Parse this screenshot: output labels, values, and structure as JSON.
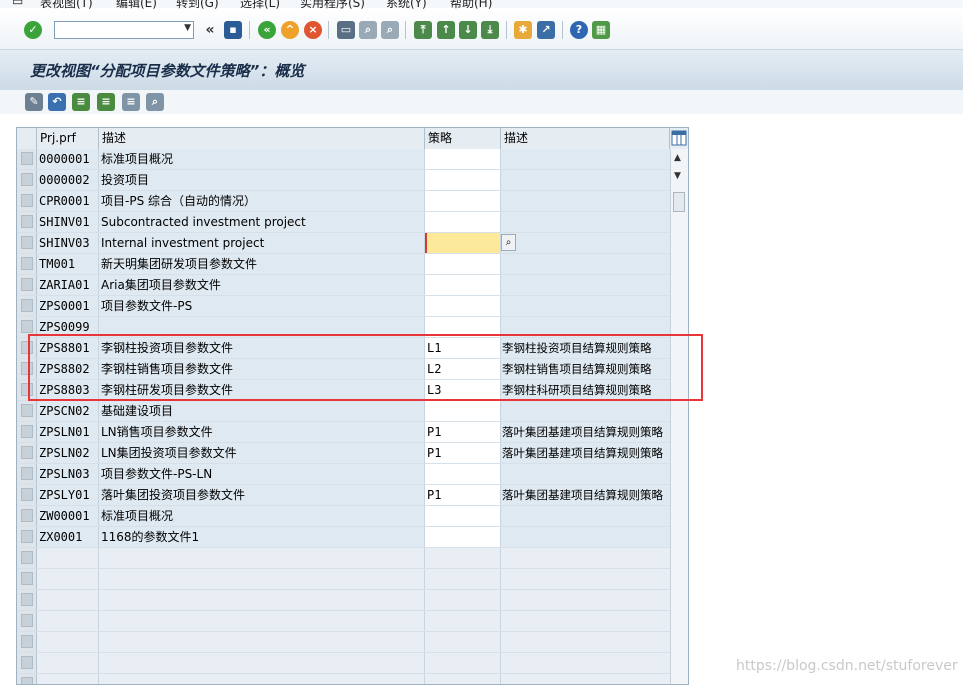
{
  "menu": [
    "表视图(T)",
    "编辑(E)",
    "转到(G)",
    "选择(L)",
    "实用程序(S)",
    "系统(Y)",
    "帮助(H)"
  ],
  "toolbar": {
    "command_field_value": "",
    "icons": [
      "enter-icon",
      "back-icon",
      "save-icon",
      "back-nav-icon",
      "exit-icon",
      "cancel-icon",
      "print-icon",
      "find-icon",
      "find-next-icon",
      "first-page-icon",
      "prev-page-icon",
      "next-page-icon",
      "last-page-icon",
      "new-session-icon",
      "shortcut-icon",
      "help-icon",
      "layout-icon"
    ]
  },
  "title": "更改视图“分配项目参数文件策略”：概览",
  "app_toolbar_icons": [
    "display-change-icon",
    "undo-icon",
    "select-all-icon",
    "select-block-icon",
    "deselect-icon",
    "other-entry-icon"
  ],
  "table": {
    "headers": [
      "Prj.prf",
      "描述",
      "策略",
      "描述"
    ],
    "rows": [
      {
        "prof": "0000001",
        "desc": "标准项目概况",
        "strat": "",
        "sdesc": ""
      },
      {
        "prof": "0000002",
        "desc": "投资项目",
        "strat": "",
        "sdesc": ""
      },
      {
        "prof": "CPR0001",
        "desc": "项目-PS 综合（自动的情况）",
        "strat": "",
        "sdesc": ""
      },
      {
        "prof": "SHINV01",
        "desc": "Subcontracted investment project",
        "strat": "",
        "sdesc": ""
      },
      {
        "prof": "SHINV03",
        "desc": "Internal investment project",
        "strat": "",
        "sdesc": ""
      },
      {
        "prof": "TM001",
        "desc": "新天明集团研发项目参数文件",
        "strat": "",
        "sdesc": ""
      },
      {
        "prof": "ZARIA01",
        "desc": "Aria集团项目参数文件",
        "strat": "",
        "sdesc": ""
      },
      {
        "prof": "ZPS0001",
        "desc": "项目参数文件-PS",
        "strat": "",
        "sdesc": ""
      },
      {
        "prof": "ZPS0099",
        "desc": "",
        "strat": "",
        "sdesc": ""
      },
      {
        "prof": "ZPS8801",
        "desc": "李钢柱投资项目参数文件",
        "strat": "L1",
        "sdesc": "李钢柱投资项目结算规则策略"
      },
      {
        "prof": "ZPS8802",
        "desc": "李钢柱销售项目参数文件",
        "strat": "L2",
        "sdesc": "李钢柱销售项目结算规则策略"
      },
      {
        "prof": "ZPS8803",
        "desc": "李钢柱研发项目参数文件",
        "strat": "L3",
        "sdesc": "李钢柱科研项目结算规则策略"
      },
      {
        "prof": "ZPSCN02",
        "desc": "基础建设项目",
        "strat": "",
        "sdesc": ""
      },
      {
        "prof": "ZPSLN01",
        "desc": "LN销售项目参数文件",
        "strat": "P1",
        "sdesc": "落叶集团基建项目结算规则策略"
      },
      {
        "prof": "ZPSLN02",
        "desc": "LN集团投资项目参数文件",
        "strat": "P1",
        "sdesc": "落叶集团基建项目结算规则策略"
      },
      {
        "prof": "ZPSLN03",
        "desc": "项目参数文件-PS-LN",
        "strat": "",
        "sdesc": ""
      },
      {
        "prof": "ZPSLY01",
        "desc": "落叶集团投资项目参数文件",
        "strat": "P1",
        "sdesc": "落叶集团基建项目结算规则策略"
      },
      {
        "prof": "ZW00001",
        "desc": "标准项目概况",
        "strat": "",
        "sdesc": ""
      },
      {
        "prof": "ZX0001",
        "desc": "1168的参数文件1",
        "strat": "",
        "sdesc": ""
      }
    ],
    "empty_rows": 7
  },
  "watermark": "https://blog.csdn.net/stuforever",
  "colors": {
    "highlight": "#e8353a",
    "focus_cell": "#fde99a",
    "cell_bg": "#dfe9f1"
  }
}
